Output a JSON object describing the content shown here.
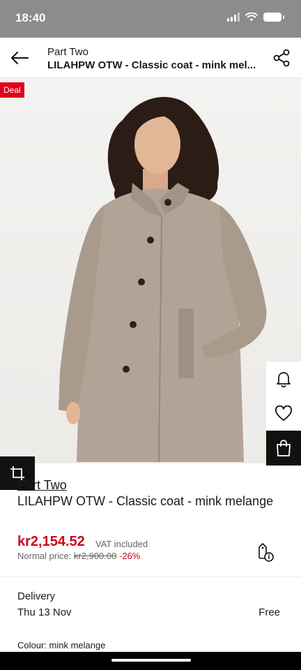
{
  "status_bar": {
    "time": "18:40"
  },
  "header": {
    "brand": "Part Two",
    "title_truncated": "LILAHPW OTW - Classic coat - mink mel..."
  },
  "badge": {
    "deal": "Deal"
  },
  "product": {
    "brand": "Part Two",
    "name": "LILAHPW OTW - Classic coat - mink melange",
    "price": "kr2,154.52",
    "vat_note": "VAT included",
    "normal_price_label": "Normal price:",
    "normal_price": "kr2,900.00",
    "discount": "-26%"
  },
  "delivery": {
    "label": "Delivery",
    "date": "Thu 13 Nov",
    "cost": "Free"
  },
  "colour": {
    "label": "Colour: mink melange"
  },
  "colors": {
    "sale_red": "#d0021b",
    "deal_red": "#e0001b",
    "coat": "#b3a396",
    "hair": "#2b1d16",
    "dark_button": "#111111"
  }
}
